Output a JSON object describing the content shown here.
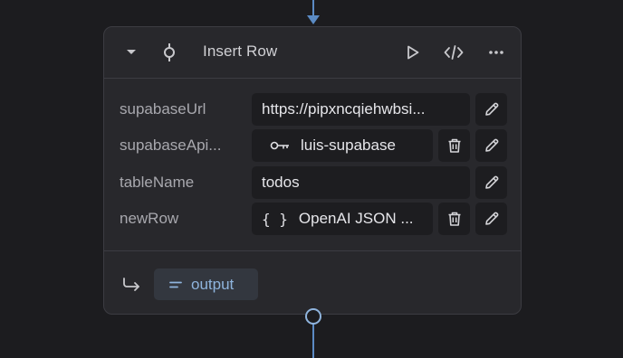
{
  "node": {
    "title": "Insert Row",
    "icons": {
      "collapse": "chevron-down-icon",
      "step": "commit-icon",
      "run": "play-icon",
      "code": "code-icon",
      "more": "more-icon"
    },
    "fields": [
      {
        "label": "supabaseUrl",
        "value": "https://pipxncqiehwbsi..."
      },
      {
        "label": "supabaseApi...",
        "value": "luis-supabase",
        "icon": "key-icon"
      },
      {
        "label": "tableName",
        "value": "todos"
      },
      {
        "label": "newRow",
        "value": "OpenAI JSON ...",
        "prefix": "{ }"
      }
    ],
    "output": {
      "label": "output",
      "icon": "return-arrow-icon"
    }
  },
  "colors": {
    "background": "#1c1c1f",
    "node": "#28282c",
    "field": "#1d1d20",
    "wire": "#5b8bc4",
    "output_text": "#8fb4dd"
  }
}
